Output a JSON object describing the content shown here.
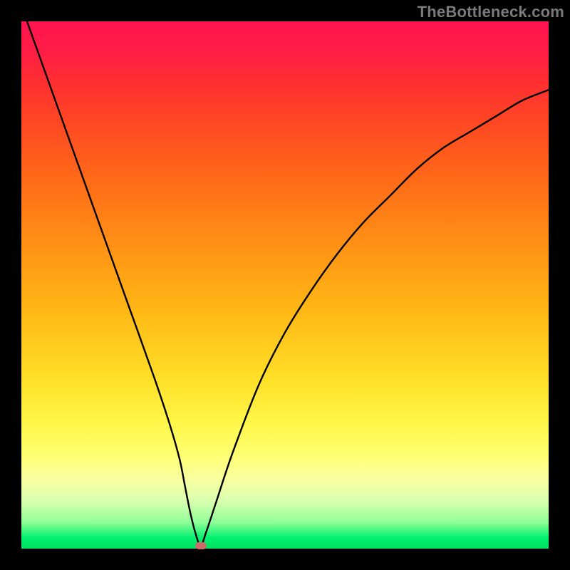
{
  "watermark": {
    "text": "TheBottleneck.com"
  },
  "chart_data": {
    "type": "line",
    "title": "",
    "xlabel": "",
    "ylabel": "",
    "xlim": [
      0,
      100
    ],
    "ylim": [
      0,
      100
    ],
    "grid": false,
    "series": [
      {
        "name": "curve",
        "x": [
          0,
          5,
          10,
          15,
          20,
          25,
          28,
          30,
          31,
          32,
          33,
          34,
          35,
          37,
          40,
          45,
          50,
          55,
          60,
          65,
          70,
          75,
          80,
          85,
          90,
          95,
          100
        ],
        "values": [
          103,
          89,
          75,
          61,
          47,
          33,
          24,
          17,
          12,
          7,
          3,
          0.5,
          3,
          9,
          18,
          31,
          41,
          49,
          56,
          62,
          67,
          72,
          76,
          79,
          82,
          85,
          87
        ]
      }
    ],
    "marker": {
      "x": 34,
      "y": 0.5
    },
    "background_gradient": {
      "stops": [
        {
          "pos": 0,
          "color": "#ff1450"
        },
        {
          "pos": 12,
          "color": "#ff3030"
        },
        {
          "pos": 30,
          "color": "#ff6a18"
        },
        {
          "pos": 55,
          "color": "#ffb815"
        },
        {
          "pos": 76,
          "color": "#fff648"
        },
        {
          "pos": 91,
          "color": "#d8ffb0"
        },
        {
          "pos": 100,
          "color": "#00e060"
        }
      ]
    }
  }
}
